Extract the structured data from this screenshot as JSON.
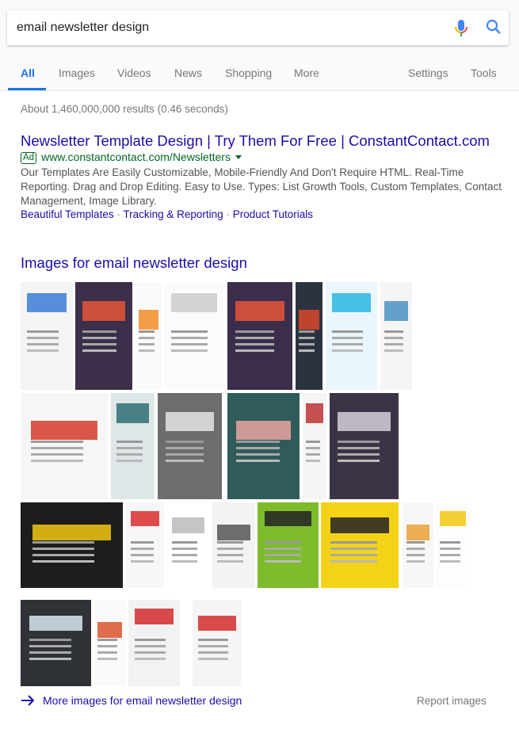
{
  "search": {
    "query": "email newsletter design",
    "mic_icon": "microphone-icon",
    "search_icon": "search-icon"
  },
  "tabs": [
    {
      "label": "All",
      "active": true
    },
    {
      "label": "Images"
    },
    {
      "label": "Videos"
    },
    {
      "label": "News"
    },
    {
      "label": "Shopping"
    },
    {
      "label": "More"
    }
  ],
  "tools": {
    "settings": "Settings",
    "tools": "Tools"
  },
  "stats": "About 1,460,000,000 results (0.46 seconds)",
  "ad": {
    "title": "Newsletter Template Design | Try Them For Free | ConstantContact.com",
    "badge": "Ad",
    "url": "www.constantcontact.com/Newsletters",
    "description": "Our Templates Are Easily Customizable, Mobile-Friendly And Don't Require HTML. Real-Time Reporting. Drag and Drop Editing. Easy to Use. Types: List Growth Tools, Custom Templates, Contact Management, Image Library.",
    "sitelinks": [
      "Beautiful Templates",
      "Tracking & Reporting",
      "Product Tutorials"
    ],
    "separator": "·"
  },
  "images": {
    "heading": "Images for email newsletter design",
    "more_label": "More images for email newsletter design",
    "report_label": "Report images"
  },
  "colors": {
    "link": "#1a0dab",
    "url": "#006621",
    "accent": "#1a73e8",
    "muted": "#777777"
  }
}
